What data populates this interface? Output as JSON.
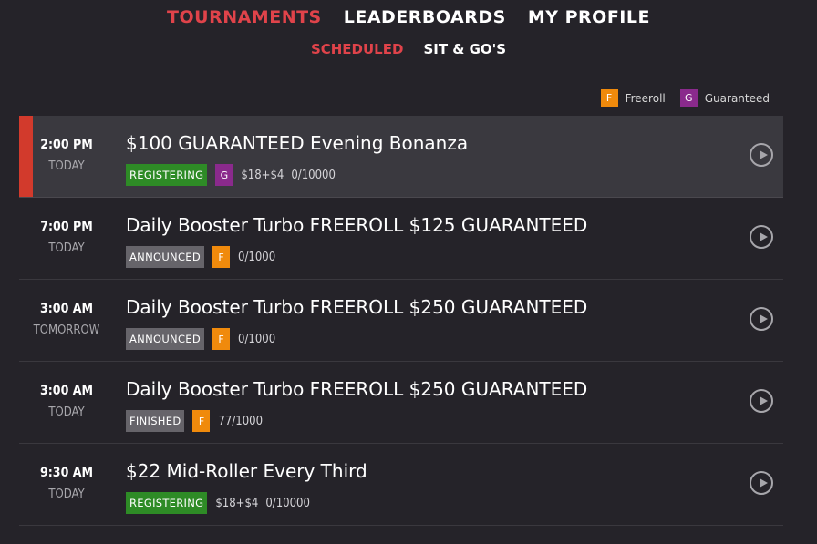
{
  "nav": {
    "tabs": [
      {
        "label": "TOURNAMENTS",
        "active": true
      },
      {
        "label": "LEADERBOARDS",
        "active": false
      },
      {
        "label": "MY PROFILE",
        "active": false
      }
    ],
    "subtabs": [
      {
        "label": "SCHEDULED",
        "active": true
      },
      {
        "label": "SIT & GO'S",
        "active": false
      }
    ]
  },
  "legend": [
    {
      "code": "F",
      "label": "Freeroll",
      "color": "#f08a0c"
    },
    {
      "code": "G",
      "label": "Guaranteed",
      "color": "#8a2a8c"
    }
  ],
  "colors": {
    "accent": "#e0434a",
    "registering": "#2e8b26",
    "announced": "#66646a",
    "freeroll": "#f08a0c",
    "guaranteed": "#8a2a8c"
  },
  "tournaments": [
    {
      "time": "2:00 PM",
      "day": "TODAY",
      "title": "$100 GUARANTEED Evening Bonanza",
      "status": "REGISTERING",
      "status_key": "registering",
      "type": "G",
      "fee": "$18+$4",
      "entrants": "0/10000",
      "selected": true,
      "action_icon": "play-icon"
    },
    {
      "time": "7:00 PM",
      "day": "TODAY",
      "title": "Daily Booster Turbo FREEROLL $125 GUARANTEED",
      "status": "ANNOUNCED",
      "status_key": "announced",
      "type": "F",
      "fee": "",
      "entrants": "0/1000",
      "selected": false,
      "action_icon": "play-icon"
    },
    {
      "time": "3:00 AM",
      "day": "TOMORROW",
      "title": "Daily Booster Turbo FREEROLL $250 GUARANTEED",
      "status": "ANNOUNCED",
      "status_key": "announced",
      "type": "F",
      "fee": "",
      "entrants": "0/1000",
      "selected": false,
      "action_icon": "play-icon"
    },
    {
      "time": "3:00 AM",
      "day": "TODAY",
      "title": "Daily Booster Turbo FREEROLL $250 GUARANTEED",
      "status": "FINISHED",
      "status_key": "finished",
      "type": "F",
      "fee": "",
      "entrants": "77/1000",
      "selected": false,
      "action_icon": "play-icon"
    },
    {
      "time": "9:30 AM",
      "day": "TODAY",
      "title": "$22 Mid-Roller Every Third",
      "status": "REGISTERING",
      "status_key": "registering",
      "type": "",
      "fee": "$18+$4",
      "entrants": "0/10000",
      "selected": false,
      "action_icon": "play-icon"
    }
  ]
}
